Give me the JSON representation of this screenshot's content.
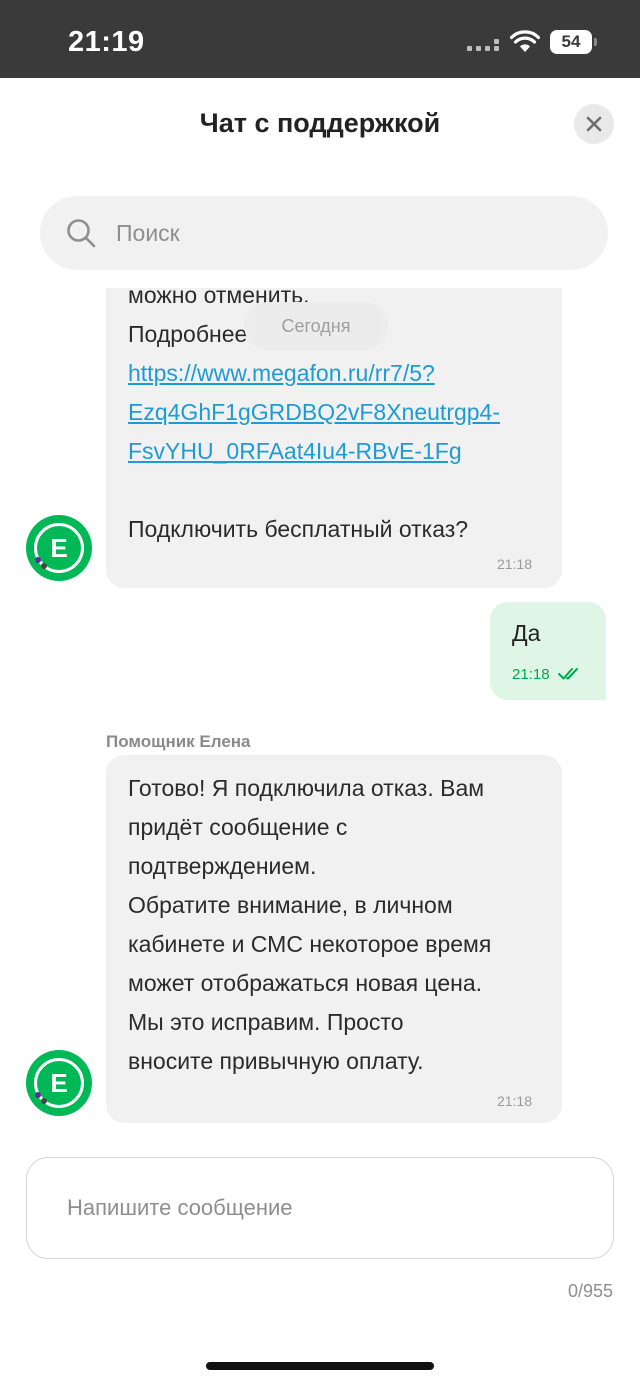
{
  "status_bar": {
    "time": "21:19",
    "battery": "54"
  },
  "header": {
    "title": "Чат с поддержкой"
  },
  "search": {
    "placeholder": "Поиск"
  },
  "date_chip": "Сегодня",
  "messages": [
    {
      "direction": "incoming",
      "lines_before_link": "можно отменить.\nПодробнее",
      "link": "https://www.megafon.ru/rr7/5?Ezq4GhF1gGRDBQ2vF8Xneutrgp4-FsvYHU_0RFAat4Iu4-RBvE-1Fg",
      "link_lines": [
        "https://www.megafon.ru/rr7/5?",
        "Ezq4GhF1gGRDBQ2vF8Xneutrgp4-",
        "FsvYHU_0RFAat4Iu4-RBvE-1Fg"
      ],
      "text_after_link": "Подключить бесплатный отказ?",
      "time": "21:18",
      "avatar_letter": "E"
    },
    {
      "direction": "outgoing",
      "text": "Да",
      "time": "21:18",
      "status_icon": "double-check-icon"
    },
    {
      "direction": "incoming",
      "sender": "Помощник Елена",
      "text": "Готово! Я подключила отказ. Вам\nпридёт сообщение с\nподтверждением.\nОбратите внимание, в личном\nкабинете и СМС некоторое время\nможет отображаться новая цена.\nМы это исправим. Просто\nвносите привычную оплату.",
      "time": "21:18",
      "avatar_letter": "E"
    }
  ],
  "composer": {
    "placeholder": "Напишите сообщение",
    "counter": "0/955"
  },
  "colors": {
    "brand": "#00b956",
    "link": "#1f9bd4",
    "outgoing_bubble": "#dff6e7",
    "incoming_bubble": "#f1f1f1"
  }
}
